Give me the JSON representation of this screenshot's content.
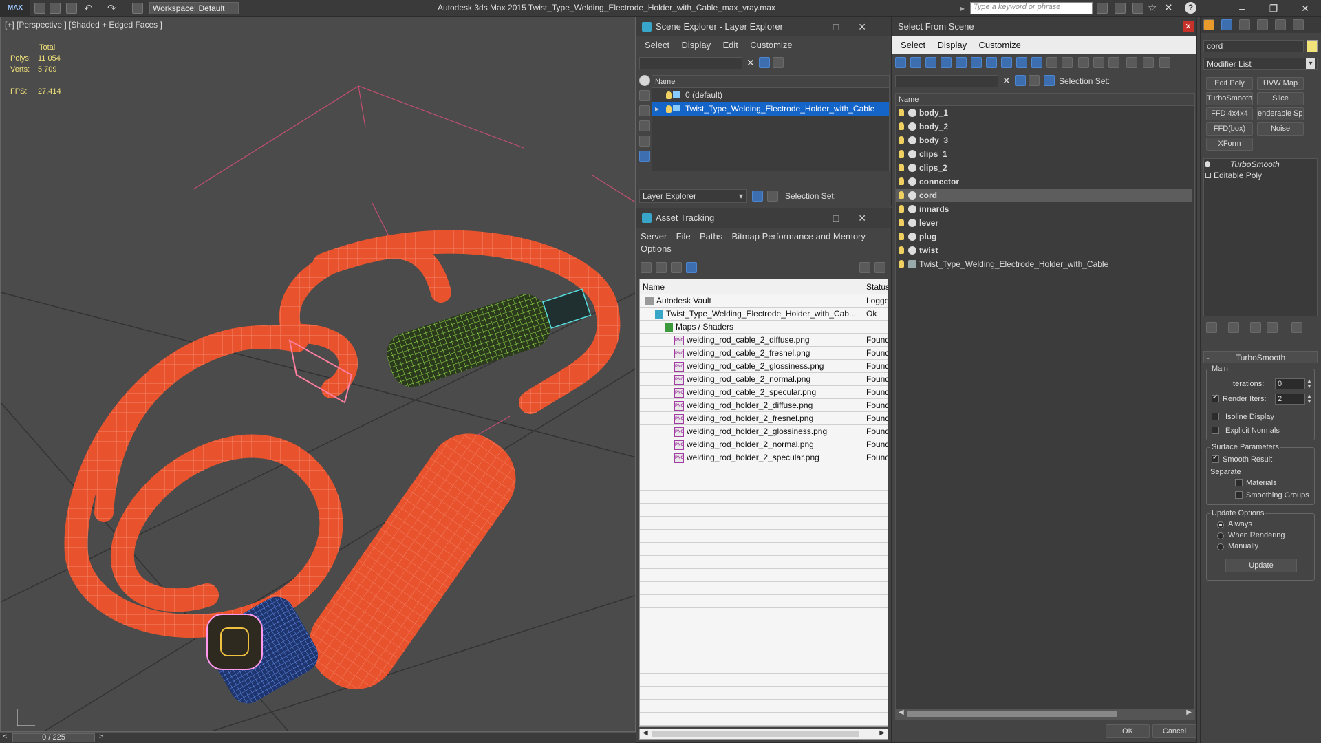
{
  "titlebar": {
    "logo": "MAX",
    "workspace": "Workspace: Default",
    "app_title": "Autodesk 3ds Max  2015     Twist_Type_Welding_Electrode_Holder_with_Cable_max_vray.max",
    "search_placeholder": "Type a keyword or phrase"
  },
  "viewport": {
    "label": "[+] [Perspective ] [Shaded + Edged Faces ]",
    "stats": {
      "total_label": "Total",
      "polys_label": "Polys:",
      "polys_value": "11 054",
      "verts_label": "Verts:",
      "verts_value": "5 709",
      "fps_label": "FPS:",
      "fps_value": "27,414"
    }
  },
  "timeline": {
    "frame": "0 / 225",
    "prev": "<",
    "next": ">"
  },
  "scene_explorer": {
    "title": "Scene Explorer - Layer Explorer",
    "menu": [
      "Select",
      "Display",
      "Edit",
      "Customize"
    ],
    "column_name": "Name",
    "layers": [
      {
        "label": "0 (default)",
        "selected": false
      },
      {
        "label": "Twist_Type_Welding_Electrode_Holder_with_Cable",
        "selected": true
      }
    ],
    "footer_dropdown": "Layer Explorer",
    "selection_set_label": "Selection Set:"
  },
  "asset_tracking": {
    "title": "Asset Tracking",
    "menu": [
      "Server",
      "File",
      "Paths",
      "Bitmap Performance and Memory",
      "Options"
    ],
    "columns": {
      "name": "Name",
      "status": "Status"
    },
    "rows": [
      {
        "name": "Autodesk Vault",
        "status": "Logged",
        "indent": 1,
        "type": "vault"
      },
      {
        "name": "Twist_Type_Welding_Electrode_Holder_with_Cab...",
        "status": "Ok",
        "indent": 2,
        "type": "max"
      },
      {
        "name": "Maps / Shaders",
        "status": "",
        "indent": 3,
        "type": "folder"
      },
      {
        "name": "welding_rod_cable_2_diffuse.png",
        "status": "Found",
        "indent": 4,
        "type": "png"
      },
      {
        "name": "welding_rod_cable_2_fresnel.png",
        "status": "Found",
        "indent": 4,
        "type": "png"
      },
      {
        "name": "welding_rod_cable_2_glossiness.png",
        "status": "Found",
        "indent": 4,
        "type": "png"
      },
      {
        "name": "welding_rod_cable_2_normal.png",
        "status": "Found",
        "indent": 4,
        "type": "png"
      },
      {
        "name": "welding_rod_cable_2_specular.png",
        "status": "Found",
        "indent": 4,
        "type": "png"
      },
      {
        "name": "welding_rod_holder_2_diffuse.png",
        "status": "Found",
        "indent": 4,
        "type": "png"
      },
      {
        "name": "welding_rod_holder_2_fresnel.png",
        "status": "Found",
        "indent": 4,
        "type": "png"
      },
      {
        "name": "welding_rod_holder_2_glossiness.png",
        "status": "Found",
        "indent": 4,
        "type": "png"
      },
      {
        "name": "welding_rod_holder_2_normal.png",
        "status": "Found",
        "indent": 4,
        "type": "png"
      },
      {
        "name": "welding_rod_holder_2_specular.png",
        "status": "Found",
        "indent": 4,
        "type": "png"
      }
    ],
    "png_badge": "PNG"
  },
  "select_from_scene": {
    "title": "Select From Scene",
    "menu": [
      "Select",
      "Display",
      "Customize"
    ],
    "selection_set_label": "Selection Set:",
    "column_name": "Name",
    "objects": [
      {
        "label": "body_1",
        "selected": false
      },
      {
        "label": "body_2",
        "selected": false
      },
      {
        "label": "body_3",
        "selected": false
      },
      {
        "label": "clips_1",
        "selected": false
      },
      {
        "label": "clips_2",
        "selected": false
      },
      {
        "label": "connector",
        "selected": false
      },
      {
        "label": "cord",
        "selected": true
      },
      {
        "label": "innards",
        "selected": false
      },
      {
        "label": "lever",
        "selected": false
      },
      {
        "label": "plug",
        "selected": false
      },
      {
        "label": "twist",
        "selected": false
      },
      {
        "label": "Twist_Type_Welding_Electrode_Holder_with_Cable",
        "selected": false,
        "group": true
      }
    ],
    "ok_label": "OK",
    "cancel_label": "Cancel"
  },
  "command_panel": {
    "object_name": "cord",
    "modifier_list": "Modifier List",
    "buttons": [
      "Edit Poly",
      "UVW Map",
      "TurboSmooth",
      "Slice",
      "FFD 4x4x4",
      "enderable Splin",
      "FFD(box)",
      "Noise",
      "XForm"
    ],
    "stack": [
      "TurboSmooth",
      "Editable Poly"
    ],
    "rollout": {
      "title": "TurboSmooth",
      "main_label": "Main",
      "iterations_label": "Iterations:",
      "iterations_value": "0",
      "render_iters_label": "Render Iters:",
      "render_iters_value": "2",
      "isoline_label": "Isoline Display",
      "explicit_normals_label": "Explicit Normals",
      "surface_params_label": "Surface Parameters",
      "smooth_result_label": "Smooth Result",
      "separate_label": "Separate",
      "materials_label": "Materials",
      "smoothing_groups_label": "Smoothing Groups",
      "update_options_label": "Update Options",
      "always_label": "Always",
      "when_rendering_label": "When Rendering",
      "manually_label": "Manually",
      "update_button": "Update"
    }
  },
  "colors": {
    "cable": "#e8532e",
    "wire": "#ff9a80",
    "connector_wire": "#aaff55",
    "plug_body": "#2a48a8",
    "selected_row": "#1565c8"
  }
}
